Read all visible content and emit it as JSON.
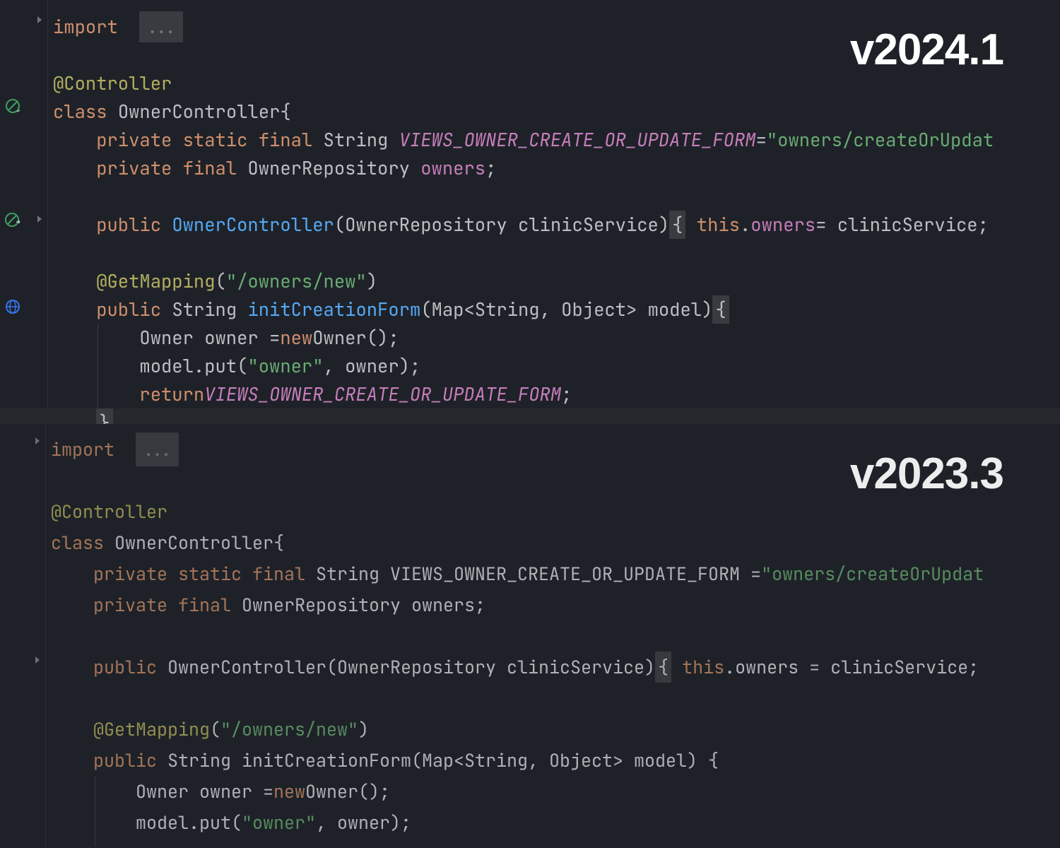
{
  "top": {
    "version": "v2024.1",
    "import_kw": "import",
    "ellipsis": "...",
    "line_ann": "@Controller",
    "class_kw": "class",
    "class_name": "OwnerController",
    "open_brace": " {",
    "l3": {
      "mods": "private static final",
      "type": "String",
      "const": "VIEWS_OWNER_CREATE_OR_UPDATE_FORM",
      "eq": " = ",
      "str": "\"owners/createOrUpdat"
    },
    "l4": {
      "mods": "private final",
      "type": "OwnerRepository",
      "fld": "owners",
      "semi": ";"
    },
    "l6": {
      "pub": "public",
      "ctor": "OwnerController",
      "params": "(OwnerRepository clinicService) ",
      "brace": "{",
      "this": "this",
      "dot": ".",
      "fld": "owners",
      "rest": " = clinicService;"
    },
    "l8": {
      "ann": "@GetMapping",
      "open": "(",
      "str": "\"/owners/new\"",
      "close": ")"
    },
    "l9": {
      "pub": "public",
      "ret": "String",
      "name": "initCreationForm",
      "params": "(Map<String, Object> model) ",
      "brace": "{"
    },
    "l10": {
      "a": "Owner owner = ",
      "new": "new",
      "b": " Owner();"
    },
    "l11": {
      "a": "model.put(",
      "str": "\"owner\"",
      "b": ", owner);"
    },
    "l12": {
      "ret": "return",
      "sp": " ",
      "const": "VIEWS_OWNER_CREATE_OR_UPDATE_FORM",
      "semi": ";"
    },
    "l13": "}"
  },
  "bottom": {
    "version": "v2023.3",
    "import_kw": "import",
    "ellipsis": "...",
    "line_ann": "@Controller",
    "class_kw": "class",
    "class_name": "OwnerController",
    "open_brace": " {",
    "l3": {
      "mods": "private static final",
      "type": "String VIEWS_OWNER_CREATE_OR_UPDATE_FORM = ",
      "str": "\"owners/createOrUpdat"
    },
    "l4": {
      "mods": "private final",
      "rest": "OwnerRepository owners;"
    },
    "l6": {
      "pub": "public",
      "rest1": "OwnerController(OwnerRepository clinicService) ",
      "brace": "{",
      "this": "this",
      "rest2": ".owners = clinicService;"
    },
    "l8": {
      "ann": "@GetMapping",
      "open": "(",
      "str": "\"/owners/new\"",
      "close": ")"
    },
    "l9": {
      "pub": "public",
      "rest": "String initCreationForm(Map<String, Object> model) {"
    },
    "l10": {
      "a": "Owner owner = ",
      "new": "new",
      "b": " Owner();"
    },
    "l11": {
      "a": "model.put(",
      "str": "\"owner\"",
      "b": ", owner);"
    }
  }
}
